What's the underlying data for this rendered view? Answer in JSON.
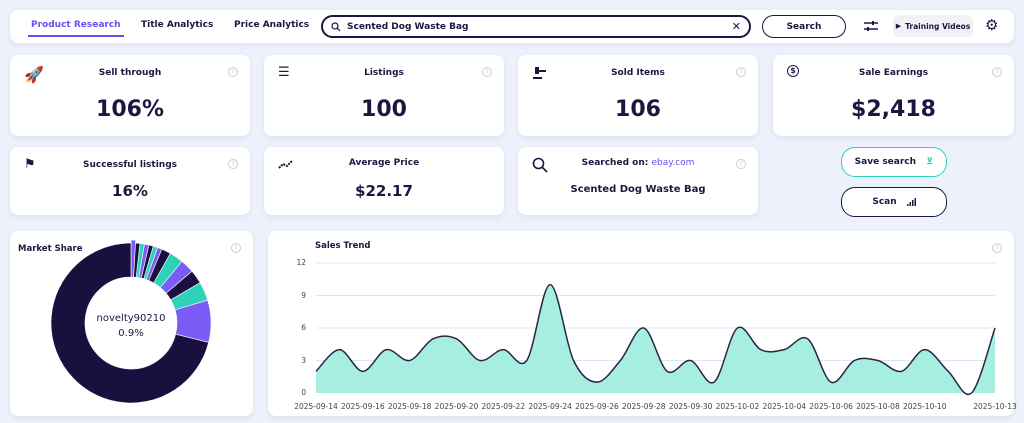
{
  "nav": {
    "tabs": [
      {
        "label": "Product Research",
        "active": true
      },
      {
        "label": "Title Analytics"
      },
      {
        "label": "Price Analytics"
      }
    ]
  },
  "search": {
    "value": "Scented Dog Waste Bag",
    "button": "Search"
  },
  "toolbar": {
    "training_videos": "Training Videos"
  },
  "stats": [
    {
      "title": "Sell through",
      "value": "106%",
      "icon": "rocket-icon"
    },
    {
      "title": "Listings",
      "value": "100",
      "icon": "list-icon"
    },
    {
      "title": "Sold Items",
      "value": "106",
      "icon": "gavel-icon"
    },
    {
      "title": "Sale Earnings",
      "value": "$2,418",
      "icon": "dollar-icon"
    },
    {
      "title": "Successful listings",
      "value": "16%",
      "icon": "flag-icon"
    },
    {
      "title": "Average Price",
      "value": "$22.17",
      "icon": "trend-icon"
    }
  ],
  "searched_on": {
    "label": "Searched on:",
    "site": "ebay.com",
    "query": "Scented Dog Waste Bag"
  },
  "actions": {
    "save_search": "Save search",
    "scan": "Scan"
  },
  "colors": {
    "accent": "#6b4cf6",
    "teal": "#2ed3b7",
    "dark": "#1a1040",
    "area": "#a6eee0"
  },
  "chart_data": [
    {
      "type": "pie",
      "title": "Market Share",
      "center_label": "novelty90210",
      "center_value": "0.9%",
      "values": [
        0.9,
        0.9,
        0.9,
        0.9,
        0.9,
        0.9,
        0.9,
        1.9,
        2.8,
        2.8,
        2.8,
        3.8,
        8.5,
        71.1
      ],
      "colors": [
        "#7b5cf7",
        "#1a1040",
        "#2ed3b7",
        "#7b5cf7",
        "#1a1040",
        "#2ed3b7",
        "#7b5cf7",
        "#1a1040",
        "#2ed3b7",
        "#7b5cf7",
        "#1a1040",
        "#2ed3b7",
        "#7b5cf7",
        "#1a1040"
      ]
    },
    {
      "type": "area",
      "title": "Sales Trend",
      "ylim": [
        0,
        12
      ],
      "yticks": [
        0,
        3,
        6,
        9,
        12
      ],
      "grid": true,
      "x": [
        "2025-09-14",
        "2025-09-15",
        "2025-09-16",
        "2025-09-17",
        "2025-09-18",
        "2025-09-19",
        "2025-09-20",
        "2025-09-21",
        "2025-09-22",
        "2025-09-23",
        "2025-09-24",
        "2025-09-25",
        "2025-09-26",
        "2025-09-27",
        "2025-09-28",
        "2025-09-29",
        "2025-09-30",
        "2025-10-01",
        "2025-10-02",
        "2025-10-03",
        "2025-10-04",
        "2025-10-05",
        "2025-10-06",
        "2025-10-07",
        "2025-10-08",
        "2025-10-09",
        "2025-10-10",
        "2025-10-11",
        "2025-10-12",
        "2025-10-13"
      ],
      "values": [
        2,
        4,
        2,
        4,
        3,
        5,
        5,
        3,
        4,
        3,
        10,
        3,
        1,
        3,
        6,
        2,
        3,
        1,
        6,
        4,
        4,
        5,
        1,
        3,
        3,
        2,
        4,
        2,
        0,
        6
      ],
      "xtick_labels": [
        "2025-09-14",
        "2025-09-16",
        "2025-09-18",
        "2025-09-20",
        "2025-09-22",
        "2025-09-24",
        "2025-09-26",
        "2025-09-28",
        "2025-09-30",
        "2025-10-02",
        "2025-10-04",
        "2025-10-06",
        "2025-10-08",
        "2025-10-10",
        "2025-10-13"
      ]
    }
  ]
}
